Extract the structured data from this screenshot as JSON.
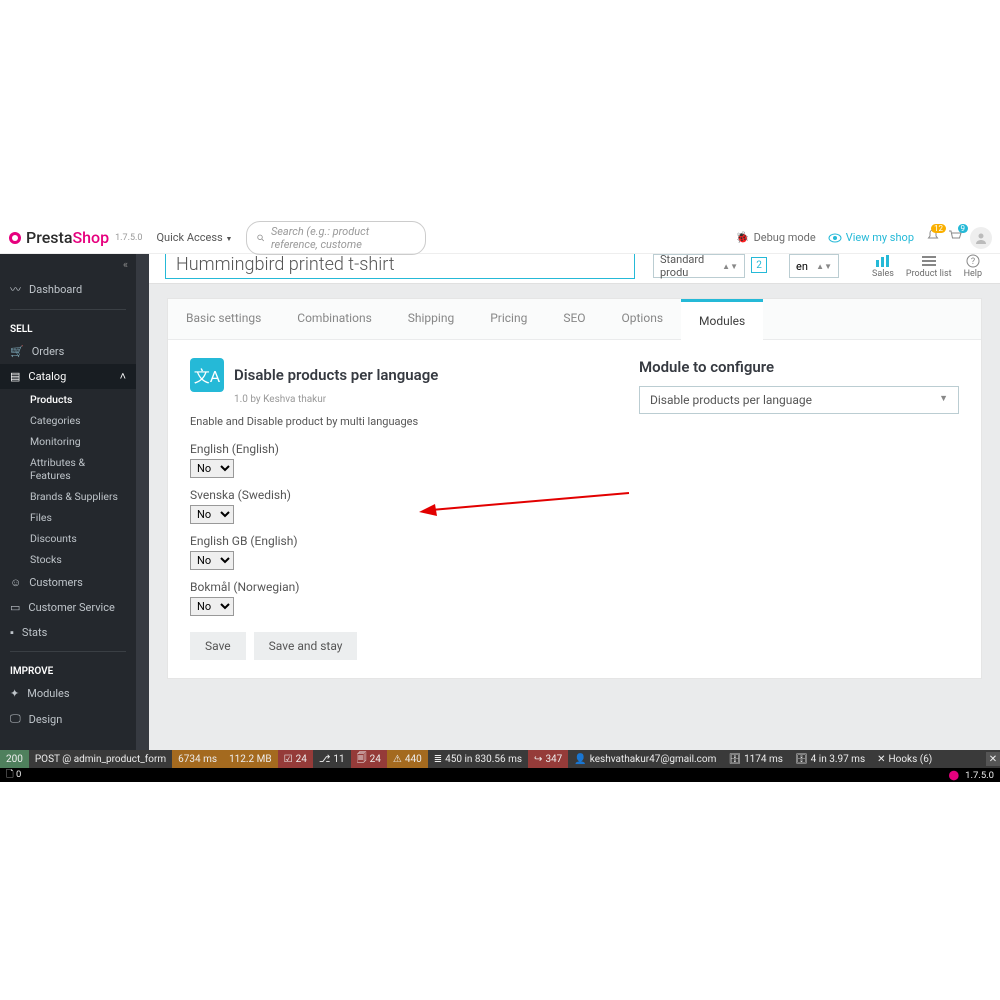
{
  "logo_presta": "Presta",
  "logo_shop": "Shop",
  "version": "1.7.5.0",
  "quick": "Quick Access",
  "quick_caret": "▼",
  "search_ph": "Search (e.g.: product reference, custome",
  "debug": "Debug mode",
  "view": "View my shop",
  "noti_bell": "12",
  "noti_cart": "9",
  "title": "Hummingbird printed t-shirt",
  "std": "Standard produ",
  "std_caret": "▲▼",
  "pg": "2",
  "lng": "en",
  "lng_caret": "▲▼",
  "st": {
    "sales": "Sales",
    "plist": "Product list",
    "help": "Help"
  },
  "nav": {
    "dash": "Dashboard",
    "sell": "SELL",
    "orders": "Orders",
    "catalog": "Catalog",
    "products": "Products",
    "categories": "Categories",
    "monitoring": "Monitoring",
    "attrs": "Attributes & Features",
    "brands": "Brands & Suppliers",
    "files": "Files",
    "discounts": "Discounts",
    "stocks": "Stocks",
    "customers": "Customers",
    "cs": "Customer Service",
    "stats": "Stats",
    "improve": "IMPROVE",
    "modules": "Modules",
    "design": "Design"
  },
  "tabs": {
    "basic": "Basic settings",
    "combo": "Combinations",
    "ship": "Shipping",
    "price": "Pricing",
    "seo": "SEO",
    "opt": "Options",
    "mod": "Modules"
  },
  "mod": {
    "title": "Disable products per language",
    "author": "1.0 by Keshva thakur",
    "desc": "Enable and Disable product by multi languages",
    "f1": "English (English)",
    "f2": "Svenska (Swedish)",
    "f3": "English GB (English)",
    "f4": "Bokmål (Norwegian)",
    "no": "No",
    "save": "Save",
    "saveStay": "Save and stay"
  },
  "right": {
    "title": "Module to configure",
    "val": "Disable products per language",
    "caret": "▼"
  },
  "foot": {
    "code": "200",
    "post": "POST @ admin_product_form",
    "ms": "6734 ms",
    "mb": "112.2 MB",
    "c1": "24",
    "c2": "11",
    "c3": "24",
    "c4": "440",
    "layers": "450 in 830.56 ms",
    "red": "347",
    "email": "keshvathakur47@gmail.com",
    "t1": "1174 ms",
    "t2": "4 in 3.97 ms",
    "hooks": "Hooks (6)",
    "zero": "0",
    "ver": "1.7.5.0"
  }
}
